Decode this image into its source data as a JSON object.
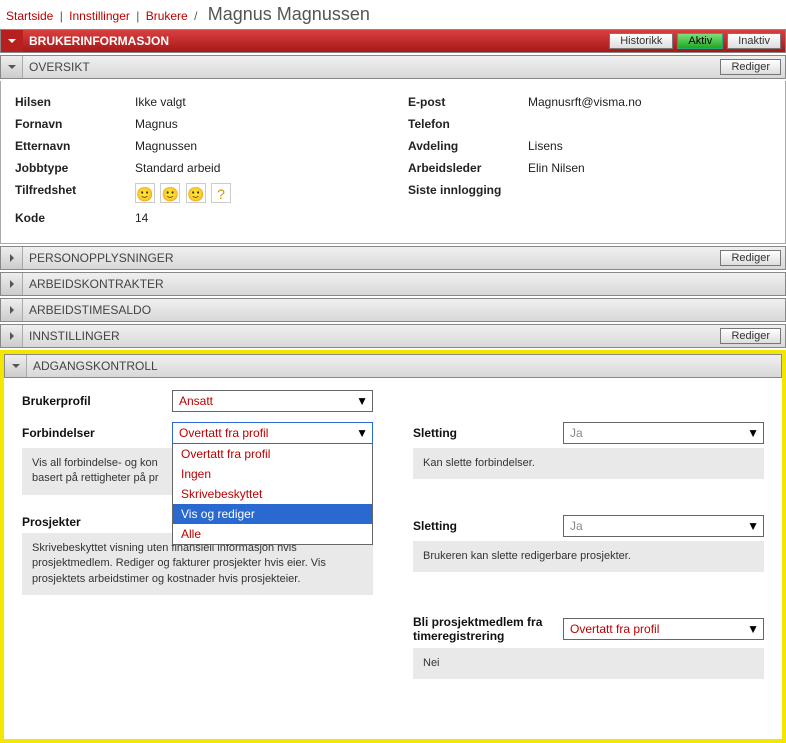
{
  "breadcrumb": {
    "items": [
      "Startside",
      "Innstillinger",
      "Brukere"
    ],
    "current": "Magnus Magnussen"
  },
  "header_red": {
    "title": "BRUKERINFORMASJON",
    "buttons": {
      "history": "Historikk",
      "active": "Aktiv",
      "inactive": "Inaktiv"
    }
  },
  "overview": {
    "title": "OVERSIKT",
    "edit": "Rediger",
    "left": {
      "hilsen_l": "Hilsen",
      "hilsen_v": "Ikke valgt",
      "fornavn_l": "Fornavn",
      "fornavn_v": "Magnus",
      "etternavn_l": "Etternavn",
      "etternavn_v": "Magnussen",
      "jobbtype_l": "Jobbtype",
      "jobbtype_v": "Standard arbeid",
      "tilfredshet_l": "Tilfredshet",
      "kode_l": "Kode",
      "kode_v": "14"
    },
    "right": {
      "epost_l": "E-post",
      "epost_v": "Magnusrft@visma.no",
      "telefon_l": "Telefon",
      "telefon_v": "",
      "avdeling_l": "Avdeling",
      "avdeling_v": "Lisens",
      "leder_l": "Arbeidsleder",
      "leder_v": "Elin Nilsen",
      "siste_l": "Siste innlogging",
      "siste_v": ""
    }
  },
  "sections": {
    "person": "PERSONOPPLYSNINGER",
    "kontrakt": "ARBEIDSKONTRAKTER",
    "saldo": "ARBEIDSTIMESALDO",
    "innst": "INNSTILLINGER",
    "adgang": "ADGANGSKONTROLL",
    "edit": "Rediger"
  },
  "access": {
    "brukerprofil_l": "Brukerprofil",
    "brukerprofil_v": "Ansatt",
    "forbindelser_l": "Forbindelser",
    "forbindelser_v": "Overtatt fra profil",
    "forbindelser_desc": "Vis all forbindelse- og kontaktinformasjon. Historikk og statistikk basert på rettigheter på prosjekt.",
    "forbindelser_desc_short1": "Vis all forbindelse- og kon",
    "forbindelser_desc_short2": "basert på rettigheter på pr",
    "dropdown": {
      "o1": "Overtatt fra profil",
      "o2": "Ingen",
      "o3": "Skrivebeskyttet",
      "o4": "Vis og rediger",
      "o5": "Alle"
    },
    "sletting_l": "Sletting",
    "sletting1_v": "Ja",
    "sletting1_desc": "Kan slette forbindelser.",
    "prosjekter_l": "Prosjekter",
    "prosjekter_desc": "Skrivebeskyttet visning uten finansiell informasjon hvis prosjektmedlem. Rediger og fakturer prosjekter hvis eier. Vis prosjektets arbeidstimer og kostnader hvis prosjekteier.",
    "sletting2_v": "Ja",
    "sletting2_desc": "Brukeren kan slette redigerbare prosjekter.",
    "medlem_l": "Bli prosjektmedlem fra timeregistrering",
    "medlem_v": "Overtatt fra profil",
    "medlem_desc": "Nei"
  }
}
